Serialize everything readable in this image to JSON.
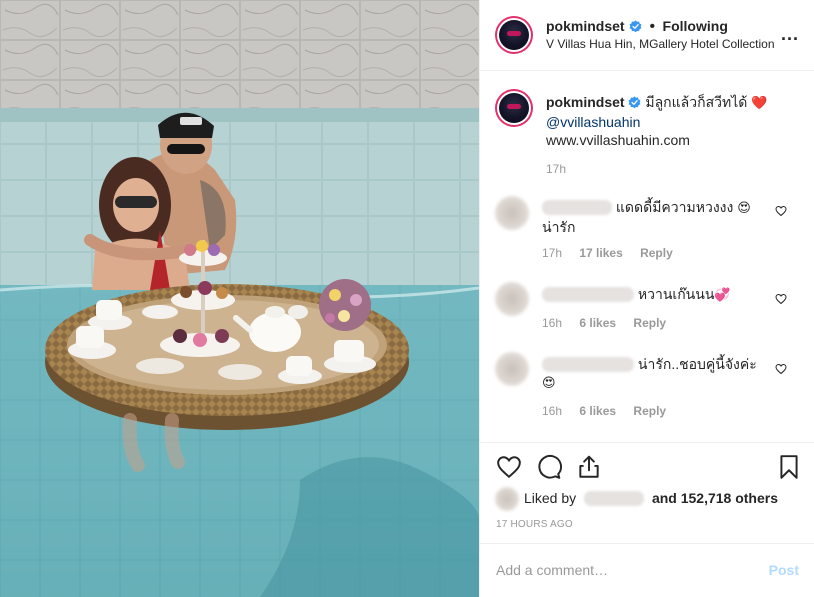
{
  "post": {
    "username": "pokmindset",
    "following_label": "Following",
    "location": "V Villas Hua Hin, MGallery Hotel Collection",
    "more_label": "...",
    "caption": {
      "username": "pokmindset",
      "text": "มีลูกแล้วก็สวีทได้",
      "heart": "❤️",
      "mention": "@vvillashuahin",
      "website": "www.vvillashuahin.com",
      "time": "17h"
    },
    "comments": [
      {
        "text": "แดดดี้มีความหวงงง 😍 น่ารัก",
        "text_line1": "แดดดี้มีความหวงงง",
        "emoji": "😍",
        "text_line2": "น่ารัก",
        "time": "17h",
        "likes": "17 likes",
        "reply": "Reply"
      },
      {
        "text": "หวานเก๊นนน💞",
        "text_line1": "หวานเก๊นนน",
        "emoji": "💞",
        "time": "16h",
        "likes": "6 likes",
        "reply": "Reply"
      },
      {
        "text": "น่ารัก..ชอบคู่นี้จังค่ะ 😍",
        "text_line1": "น่ารัก..ชอบคู่นี้จังค่ะ",
        "emoji": "😍",
        "time": "16h",
        "likes": "6 likes",
        "reply": "Reply"
      }
    ],
    "liked_by_prefix": "Liked by",
    "liked_by_suffix": "and 152,718 others",
    "time_ago": "17 HOURS AGO",
    "add_comment_placeholder": "Add a comment…",
    "post_button": "Post"
  },
  "colors": {
    "link": "#003569",
    "muted": "#999999",
    "verified": "#3897f0",
    "post_disabled": "#b3dbff",
    "pool": "#6fb3ba"
  },
  "icons": [
    "verified-badge-icon",
    "more-options-icon",
    "heart-outline-icon",
    "comment-bubble-icon",
    "share-icon",
    "bookmark-icon"
  ]
}
